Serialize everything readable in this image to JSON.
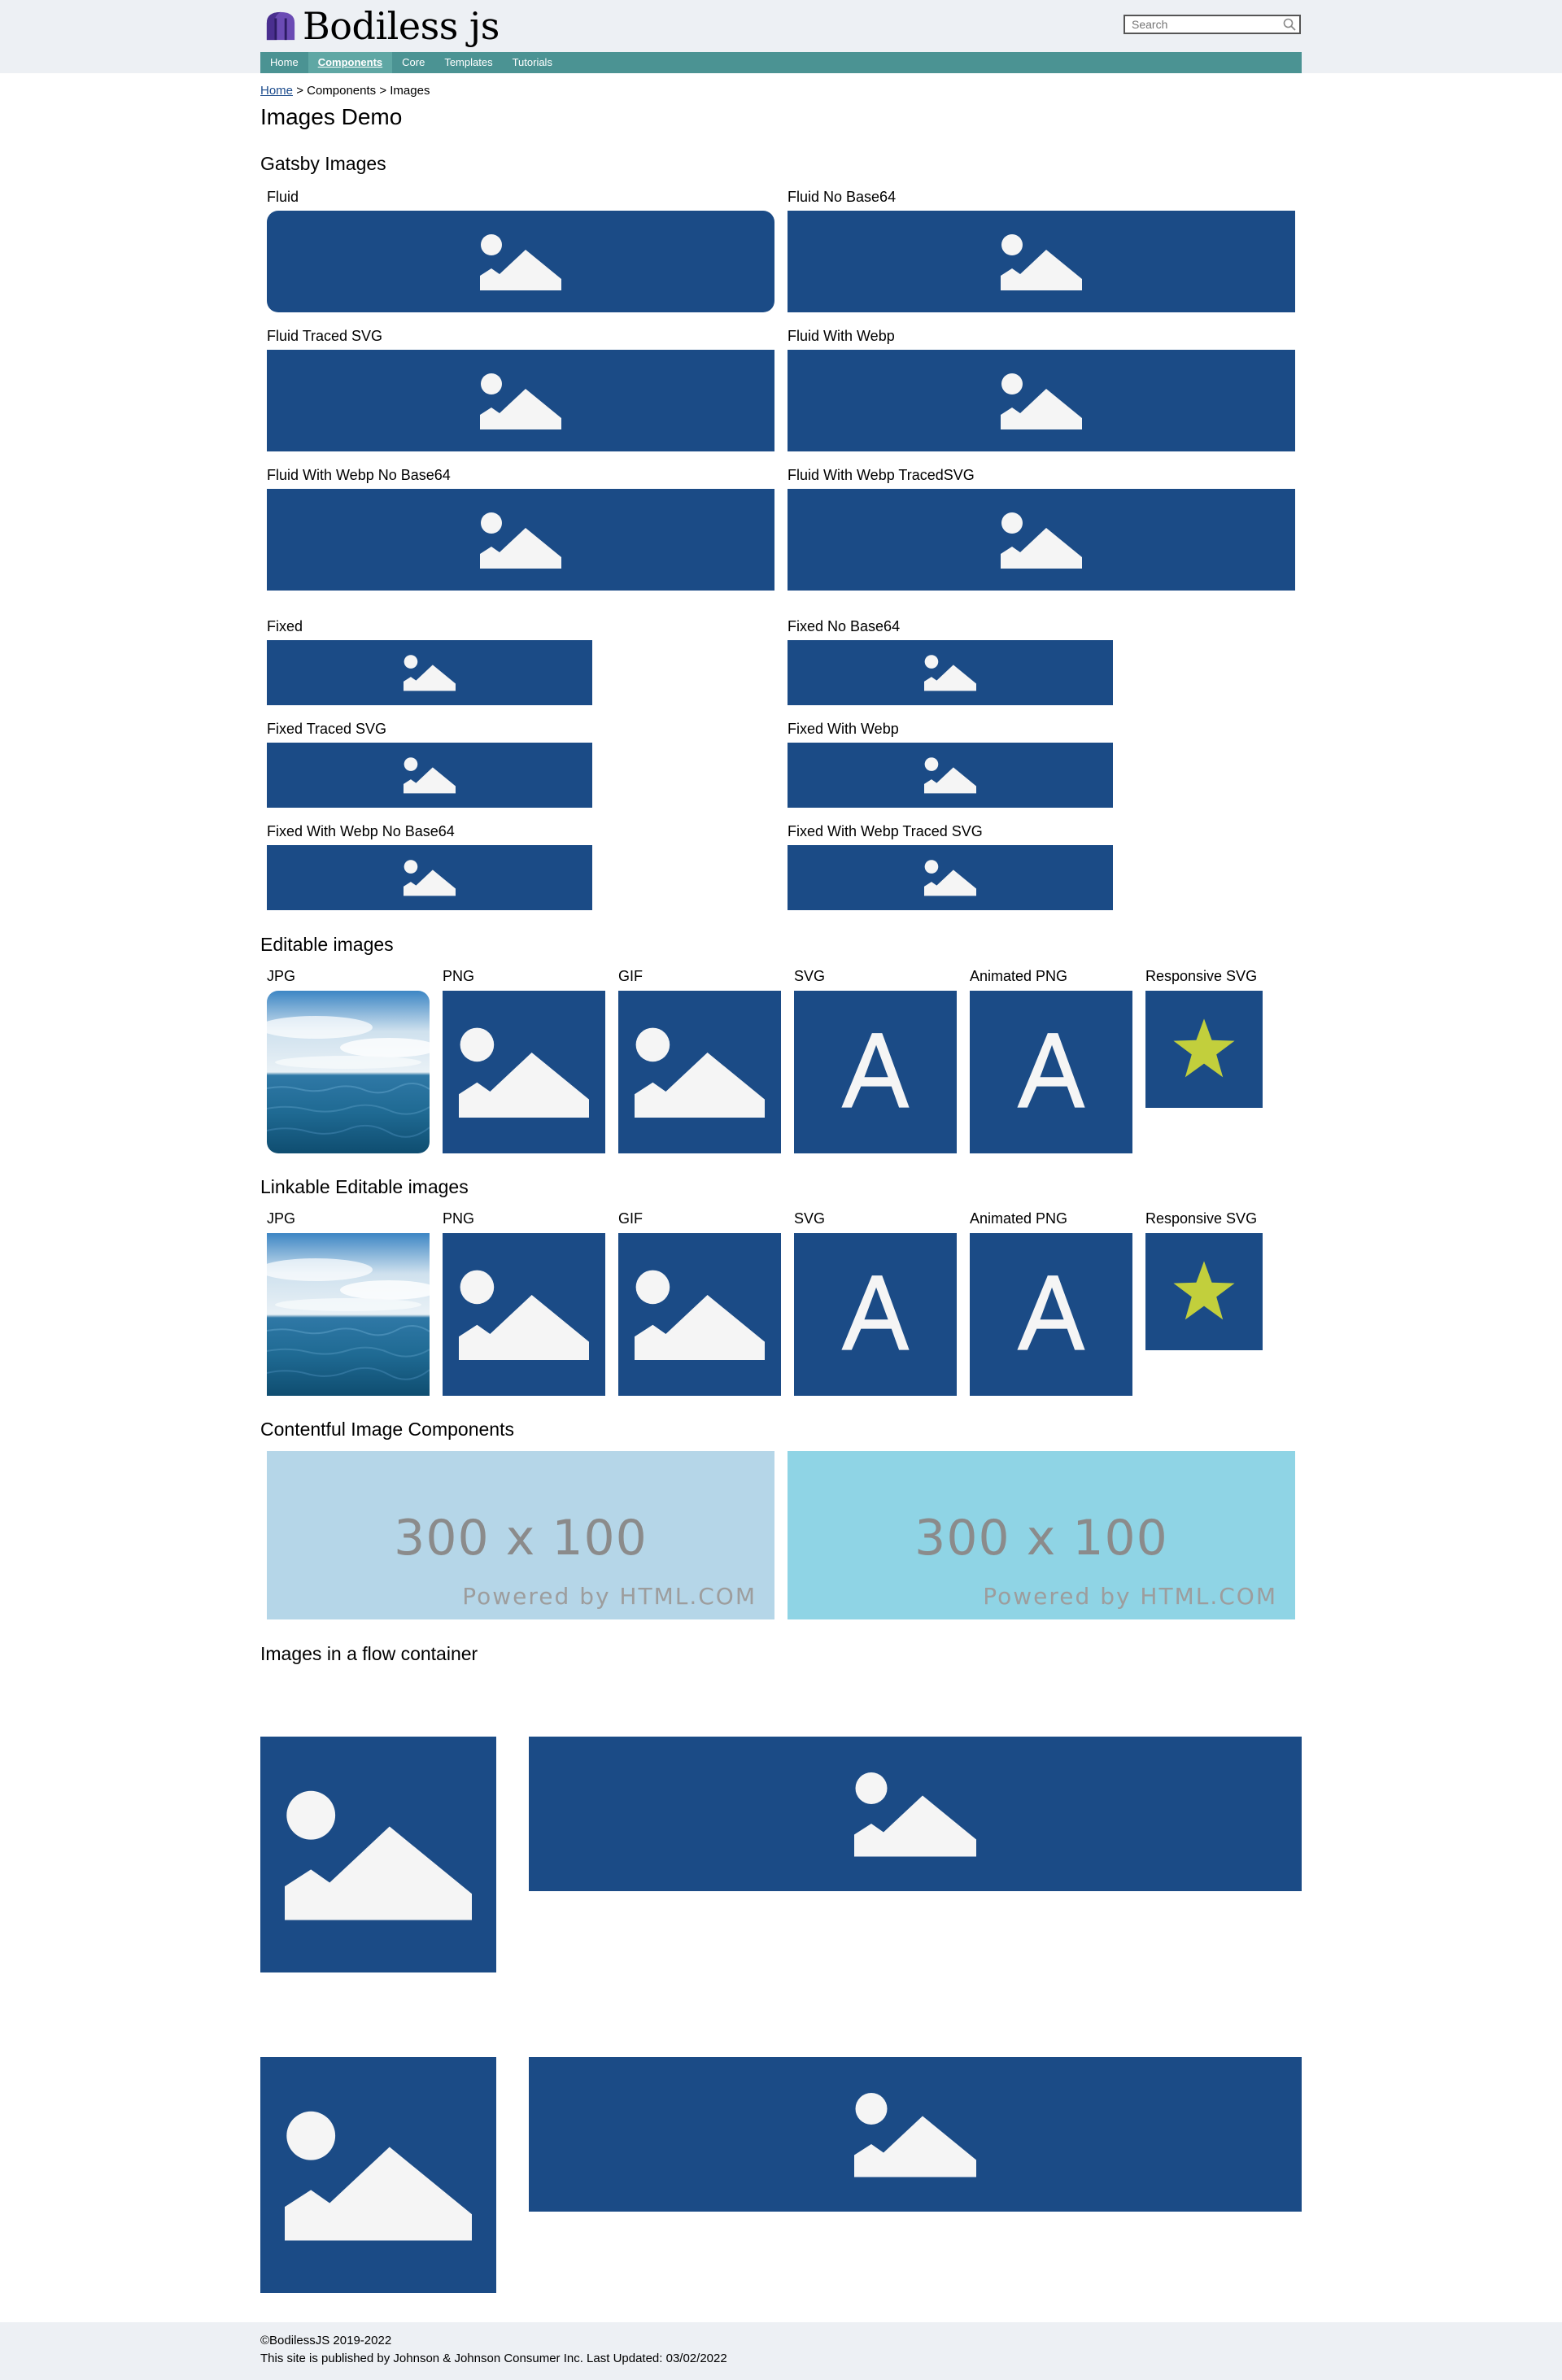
{
  "header": {
    "logo_text": "Bodiless js",
    "search_placeholder": "Search"
  },
  "nav": [
    "Home",
    "Components",
    "Core",
    "Templates",
    "Tutorials"
  ],
  "breadcrumb": {
    "home": "Home",
    "rest": "> Components > Images"
  },
  "page_title": "Images Demo",
  "sections": {
    "gatsby": "Gatsby Images",
    "editable": "Editable images",
    "linkable": "Linkable Editable images",
    "contentful": "Contentful Image Components",
    "flow": "Images in a flow container"
  },
  "gatsby_fluid": [
    "Fluid",
    "Fluid No Base64",
    "Fluid Traced SVG",
    "Fluid With Webp",
    "Fluid With Webp No Base64",
    "Fluid With Webp TracedSVG"
  ],
  "gatsby_fixed": [
    "Fixed",
    "Fixed No Base64",
    "Fixed Traced SVG",
    "Fixed With Webp",
    "Fixed With Webp No Base64",
    "Fixed With Webp Traced SVG"
  ],
  "editable_labels": [
    "JPG",
    "PNG",
    "GIF",
    "SVG",
    "Animated PNG",
    "Responsive SVG"
  ],
  "contentful": {
    "placeholder_size": "300 x 100",
    "placeholder_brand": "Powered by HTML.COM",
    "colors": [
      "#b5d6e8",
      "#8fd4e5"
    ]
  },
  "colors": {
    "tile_blue": "#1b4b86",
    "nav_teal": "#4b9393",
    "star": "#c2cf3c"
  },
  "footer": {
    "copyright": "©BodilessJS 2019-2022",
    "published": "This site is published by Johnson & Johnson Consumer Inc. Last Updated: 03/02/2022"
  }
}
